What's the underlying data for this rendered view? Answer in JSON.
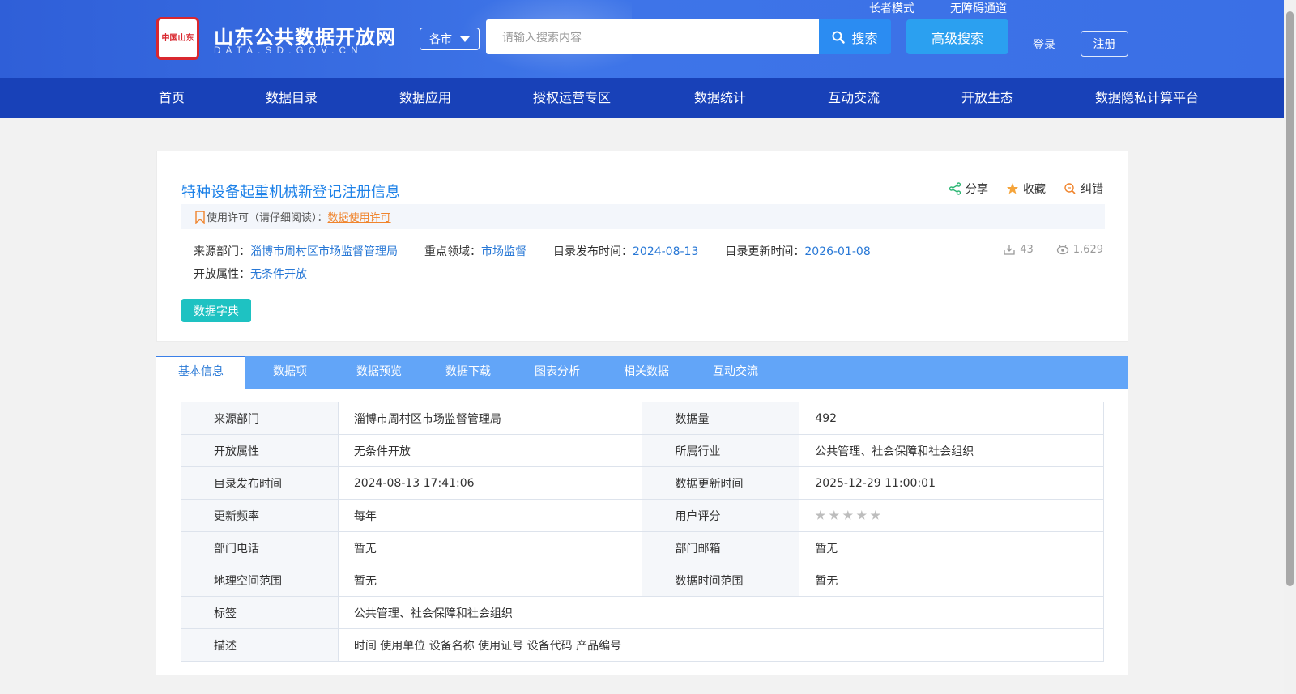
{
  "header": {
    "logo_seal": "中国山东",
    "site_title": "山东公共数据开放网",
    "site_domain": "DATA.SD.GOV.CN",
    "city_select": "各市",
    "search_placeholder": "请输入搜索内容",
    "search_label": "搜索",
    "advanced_search_label": "高级搜索",
    "elder_mode": "长者模式",
    "accessibility": "无障碍通道",
    "login": "登录",
    "register": "注册",
    "accent": "#2b8cf2"
  },
  "nav": [
    "首页",
    "数据目录",
    "数据应用",
    "授权运营专区",
    "数据统计",
    "互动交流",
    "开放生态",
    "数据隐私计算平台"
  ],
  "dataset": {
    "title": "特种设备起重机械新登记注册信息",
    "actions": {
      "share": "分享",
      "favorite": "收藏",
      "report": "纠错"
    },
    "license_label": "使用许可（请仔细阅读）：",
    "license_link": "数据使用许可",
    "source_label": "来源部门：",
    "source_value": "淄博市周村区市场监督管理局",
    "domain_label": "重点领域：",
    "domain_value": "市场监督",
    "publish_label": "目录发布时间：",
    "publish_value": "2024-08-13",
    "update_label": "目录更新时间：",
    "update_value": "2026-01-08",
    "open_label": "开放属性：",
    "open_value": "无条件开放",
    "downloads": "43",
    "views": "1,629",
    "dict_button": "数据字典"
  },
  "tabs": [
    "基本信息",
    "数据项",
    "数据预览",
    "数据下载",
    "图表分析",
    "相关数据",
    "互动交流"
  ],
  "info_table": {
    "rows": [
      {
        "k1": "来源部门",
        "v1": "淄博市周村区市场监督管理局",
        "k2": "数据量",
        "v2": "492"
      },
      {
        "k1": "开放属性",
        "v1": "无条件开放",
        "k2": "所属行业",
        "v2": "公共管理、社会保障和社会组织"
      },
      {
        "k1": "目录发布时间",
        "v1": "2024-08-13 17:41:06",
        "k2": "数据更新时间",
        "v2": "2025-12-29 11:00:01"
      },
      {
        "k1": "更新频率",
        "v1": "每年",
        "k2": "用户评分",
        "rating": 0
      },
      {
        "k1": "部门电话",
        "v1": "暂无",
        "k2": "部门邮箱",
        "v2": "暂无"
      },
      {
        "k1": "地理空间范围",
        "v1": "暂无",
        "k2": "数据时间范围",
        "v2": "暂无"
      }
    ],
    "tags_label": "标签",
    "tags_value": "公共管理、社会保障和社会组织",
    "desc_label": "描述",
    "desc_value": "时间 使用单位 设备名称 使用证号 设备代码 产品编号"
  }
}
